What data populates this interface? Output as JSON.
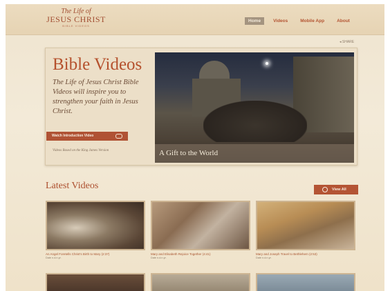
{
  "header": {
    "logo": {
      "top": "The Life of",
      "main": "JESUS CHRIST",
      "sub": "BIBLE VIDEOS"
    },
    "nav": [
      {
        "label": "Home",
        "active": true
      },
      {
        "label": "Videos"
      },
      {
        "label": "Mobile App"
      },
      {
        "label": "About"
      }
    ]
  },
  "share_label": "SHARE",
  "hero": {
    "title": "Bible Videos",
    "tagline": "The Life of Jesus Christ Bible Videos will inspire you to strengthen your faith in Jesus Christ.",
    "button_label": "Watch Introduction Video",
    "note": "Videos Based on the King James Version",
    "video_caption": "A Gift to the World"
  },
  "latest": {
    "title": "Latest Videos",
    "view_all": "View All",
    "videos": [
      {
        "title": "An Angel Foretells Christ's Birth to Mary (2:37)",
        "date": "Date n.d.n.yr."
      },
      {
        "title": "Mary and Elisabeth Rejoice Together (4:41)",
        "date": "Date n.d.n.yr."
      },
      {
        "title": "Mary and Joseph Travel to Bethlehem (2:53)",
        "date": "Date n.d.n.yr."
      }
    ]
  },
  "colors": {
    "accent": "#b5512d",
    "background": "#f0e5d1",
    "nav_active": "#a49480"
  }
}
